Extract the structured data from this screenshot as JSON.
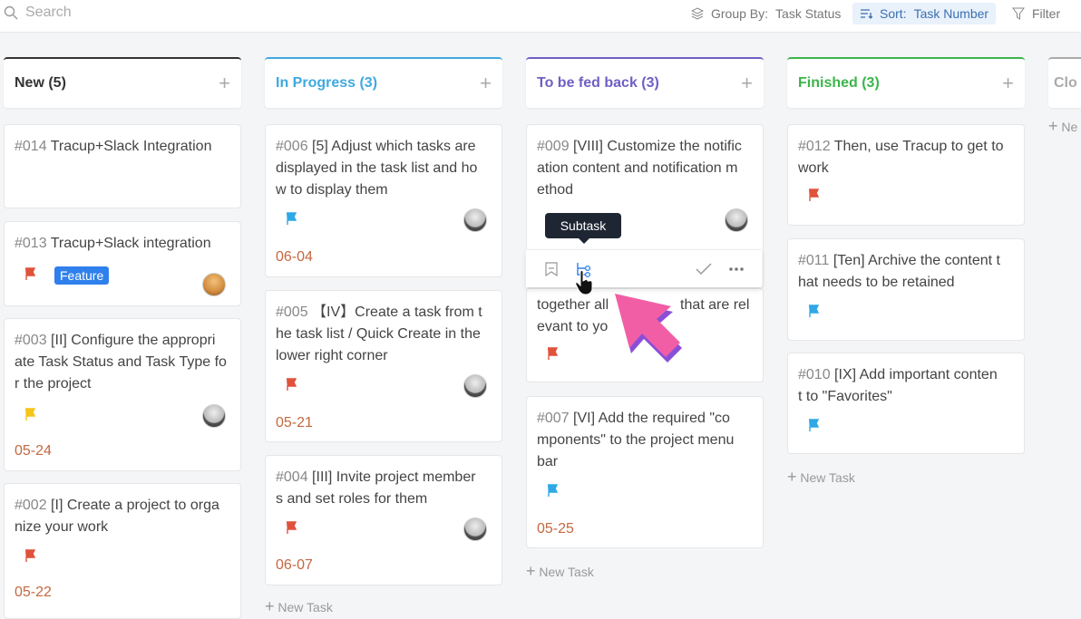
{
  "toolbar": {
    "search_placeholder": "Search",
    "group_by_label": "Group By:",
    "group_by_value": "Task Status",
    "sort_label": "Sort:",
    "sort_value": "Task Number",
    "filter_label": "Filter"
  },
  "colors": {
    "new": "#333333",
    "in_progress": "#3fa9e0",
    "to_be_fed_back": "#6f5fc4",
    "finished": "#3bb54a",
    "closed": "#aaaaaa",
    "flag_red": "#e0523a",
    "flag_blue": "#2ea8e6",
    "flag_yellow": "#f5c518",
    "date": "#c4683f",
    "accent_arrow": "#f25ea5"
  },
  "columns": [
    {
      "title": "New (5)",
      "cards": [
        {
          "num": "#014",
          "lines": [
            "Tracup+Slack Integration"
          ]
        },
        {
          "num": "#013",
          "lines": [
            "Tracup+Slack integration"
          ],
          "flag": "red",
          "badge": "Feature",
          "avatar": "orange"
        },
        {
          "num": "#003",
          "lines": [
            "[II] Configure the appropri",
            "ate Task Status and Task Type fo",
            "r the project"
          ],
          "flag": "yellow",
          "avatar": "grey",
          "date": "05-24"
        },
        {
          "num": "#002",
          "lines": [
            "[I] Create a project to orga",
            "nize your work"
          ],
          "flag": "red",
          "date": "05-22"
        }
      ]
    },
    {
      "title": "In Progress (3)",
      "cards": [
        {
          "num": "#006",
          "lines": [
            "[5] Adjust which tasks are",
            "displayed in the task list and ho",
            "w to display them"
          ],
          "flag": "blue",
          "avatar": "grey",
          "date": "06-04"
        },
        {
          "num": "#005",
          "lines": [
            "【IV】Create a task from t",
            "he task list / Quick Create in the",
            "lower right corner"
          ],
          "flag": "red",
          "avatar": "grey",
          "date": "05-21"
        },
        {
          "num": "#004",
          "lines": [
            "[III] Invite project member",
            "s and set roles for them"
          ],
          "flag": "red",
          "avatar": "grey",
          "date": "06-07"
        }
      ],
      "new_task": "New Task"
    },
    {
      "title": "To be fed back (3)",
      "cards": [
        {
          "num": "#009",
          "lines": [
            "[VIII] Customize the notific",
            "ation content and notification m",
            "ethod"
          ],
          "avatar": "grey"
        },
        {
          "lines": [
            "together all",
            "that are rel",
            "evant to yo"
          ],
          "flag": "red"
        },
        {
          "num": "#007",
          "lines": [
            "[VI] Add the required \"co",
            "mponents\" to the project menu",
            "bar"
          ],
          "flag": "blue",
          "date": "05-25"
        }
      ],
      "new_task": "New Task",
      "tooltip": "Subtask"
    },
    {
      "title": "Finished (3)",
      "cards": [
        {
          "num": "#012",
          "lines": [
            "Then, use Tracup to get to",
            "work"
          ],
          "flag": "red"
        },
        {
          "num": "#011",
          "lines": [
            "[Ten] Archive the content t",
            "hat needs to be retained"
          ],
          "flag": "blue"
        },
        {
          "num": "#010",
          "lines": [
            "[IX] Add important conten",
            "t to \"Favorites\""
          ],
          "flag": "blue"
        }
      ],
      "new_task": "New Task"
    },
    {
      "title": "Clo",
      "new_task": "Ne"
    }
  ]
}
